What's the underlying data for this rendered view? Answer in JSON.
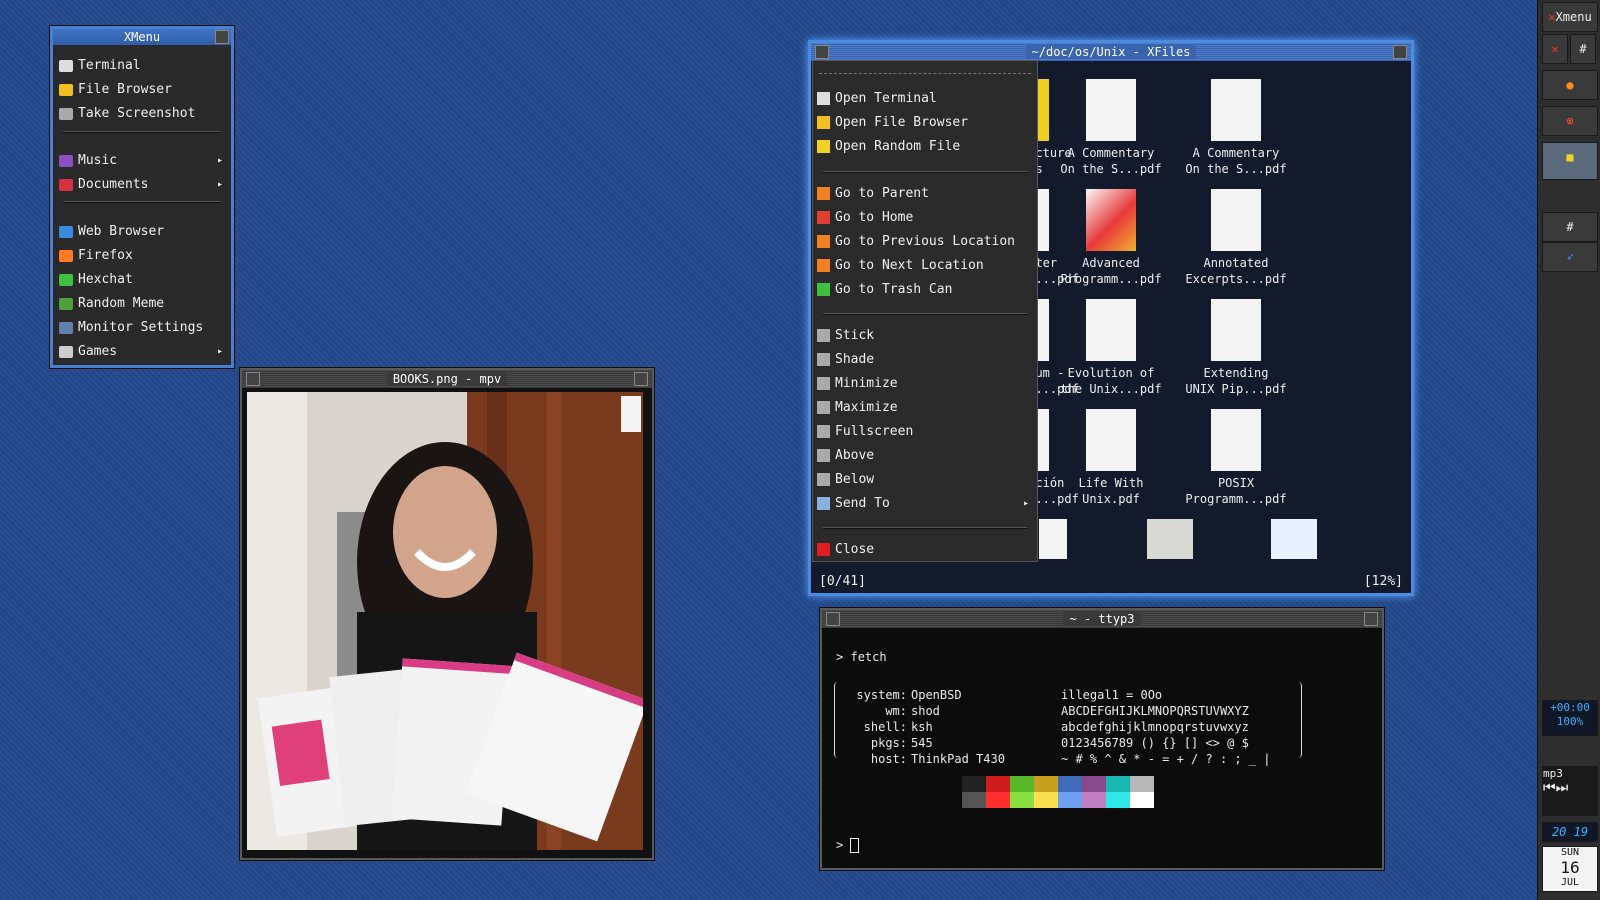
{
  "xmenu": {
    "title": "XMenu",
    "groups": [
      [
        "Terminal",
        "File Browser",
        "Take Screenshot"
      ],
      [
        "Music",
        "Documents"
      ],
      [
        "Web Browser",
        "Firefox",
        "Hexchat",
        "Random Meme",
        "Monitor Settings",
        "Games"
      ]
    ],
    "items": [
      {
        "label": "Terminal",
        "icon": "terminal-icon"
      },
      {
        "label": "File Browser",
        "icon": "folder-icon"
      },
      {
        "label": "Take Screenshot",
        "icon": "camera-icon"
      },
      {
        "label": "Music",
        "icon": "music-icon",
        "submenu": true
      },
      {
        "label": "Documents",
        "icon": "book-icon",
        "submenu": true
      },
      {
        "label": "Web Browser",
        "icon": "globe-icon"
      },
      {
        "label": "Firefox",
        "icon": "firefox-icon"
      },
      {
        "label": "Hexchat",
        "icon": "chat-icon"
      },
      {
        "label": "Random Meme",
        "icon": "image-icon"
      },
      {
        "label": "Monitor Settings",
        "icon": "monitor-icon"
      },
      {
        "label": "Games",
        "icon": "gamepad-icon",
        "submenu": true
      }
    ]
  },
  "mpv": {
    "title": "BOOKS.png - mpv"
  },
  "xfiles": {
    "title": "~/doc/os/Unix - XFiles",
    "files": [
      [
        "Lecture",
        "tes"
      ],
      [
        "A Commentary",
        "On the S...pdf"
      ],
      [
        "A Commentary",
        "On the S...pdf"
      ],
      [
        "arter",
        "y ...pdf"
      ],
      [
        "Advanced",
        "Programm...pdf"
      ],
      [
        "Annotated",
        "Excerpts...pdf"
      ],
      [
        "icum -",
        "ca...pdf"
      ],
      [
        "Evolution of",
        "the Unix...pdf"
      ],
      [
        "Extending",
        "UNIX Pip...pdf"
      ],
      [
        "ucción",
        "em...pdf"
      ],
      [
        "Life With",
        "Unix.pdf"
      ],
      [
        "POSIX",
        "Programm...pdf"
      ]
    ],
    "status_left": "[0/41]",
    "status_right": "[12%]"
  },
  "context_menu": {
    "items": [
      {
        "label": "Open Terminal",
        "icon": "terminal-icon"
      },
      {
        "label": "Open File Browser",
        "icon": "folder-icon"
      },
      {
        "label": "Open Random File",
        "icon": "star-icon"
      },
      {
        "label": "Go to Parent",
        "icon": "arrow-up-icon"
      },
      {
        "label": "Go to Home",
        "icon": "home-icon"
      },
      {
        "label": "Go to Previous Location",
        "icon": "arrow-left-icon"
      },
      {
        "label": "Go to Next Location",
        "icon": "arrow-right-icon"
      },
      {
        "label": "Go to Trash Can",
        "icon": "trash-icon"
      },
      {
        "label": "Stick",
        "icon": "pin-icon"
      },
      {
        "label": "Shade",
        "icon": "shade-icon"
      },
      {
        "label": "Minimize",
        "icon": "minimize-icon"
      },
      {
        "label": "Maximize",
        "icon": "maximize-icon"
      },
      {
        "label": "Fullscreen",
        "icon": "fullscreen-icon"
      },
      {
        "label": "Above",
        "icon": "above-icon"
      },
      {
        "label": "Below",
        "icon": "below-icon"
      },
      {
        "label": "Send To",
        "icon": "send-icon",
        "submenu": true
      },
      {
        "label": "Close",
        "icon": "close-icon"
      }
    ]
  },
  "terminal": {
    "title": "~ - ttyp3",
    "command": "fetch",
    "lines": [
      {
        "k": "system:",
        "v": "OpenBSD",
        "r": "illegal1 = 0Oo"
      },
      {
        "k": "wm:",
        "v": "shod",
        "r": "ABCDEFGHIJKLMNOPQRSTUVWXYZ"
      },
      {
        "k": "shell:",
        "v": "ksh",
        "r": "abcdefghijklmnopqrstuvwxyz"
      },
      {
        "k": "pkgs:",
        "v": "545",
        "r": "0123456789 () {} [] <> @ $"
      },
      {
        "k": "host:",
        "v": "ThinkPad T430",
        "r": "~ # % ^ & * - = + / ? : ; _ |"
      }
    ],
    "palette_top": [
      "#222222",
      "#d01c1c",
      "#58b82a",
      "#c8a020",
      "#3f6bb8",
      "#8a4a8a",
      "#1ab8b0",
      "#b8b8b8"
    ],
    "palette_bottom": [
      "#555555",
      "#ff3030",
      "#88e040",
      "#f8e050",
      "#70a0f0",
      "#c080c0",
      "#30e8e8",
      "#ffffff"
    ],
    "prompt": ">"
  },
  "dock": {
    "xmenu_label": "Xmenu",
    "time": "+00:00",
    "volume": "100%",
    "clock": "20 19",
    "weekday": "SUN",
    "day": "16",
    "month": "JUL",
    "mp3": "mp3"
  }
}
